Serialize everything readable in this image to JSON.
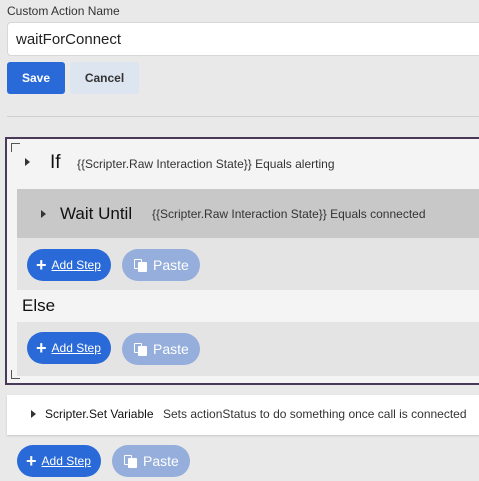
{
  "form": {
    "name_label": "Custom Action Name",
    "name_value": "waitForConnect",
    "save_label": "Save",
    "cancel_label": "Cancel"
  },
  "if_block": {
    "title": "If",
    "condition": "{{Scripter.Raw Interaction State}} Equals alerting",
    "wait_until": {
      "title": "Wait Until",
      "condition": "{{Scripter.Raw Interaction State}} Equals connected"
    },
    "then_actions": {
      "add_label": "Add Step",
      "paste_label": "Paste"
    },
    "else_title": "Else",
    "else_actions": {
      "add_label": "Add Step",
      "paste_label": "Paste"
    }
  },
  "set_variable": {
    "title": "Scripter.Set Variable",
    "description": "Sets actionStatus to do something once call is connected"
  },
  "bottom_actions": {
    "add_label": "Add Step",
    "paste_label": "Paste"
  },
  "colors": {
    "primary": "#2a6ad8",
    "primary_disabled": "#95aedb",
    "cancel_bg": "#dde5f1",
    "block_border": "#4a3a5a",
    "wait_row_bg": "#c8c8c8"
  },
  "icons": {
    "add": "plus-icon",
    "paste": "paste-icon",
    "expand": "caret-right-icon"
  }
}
